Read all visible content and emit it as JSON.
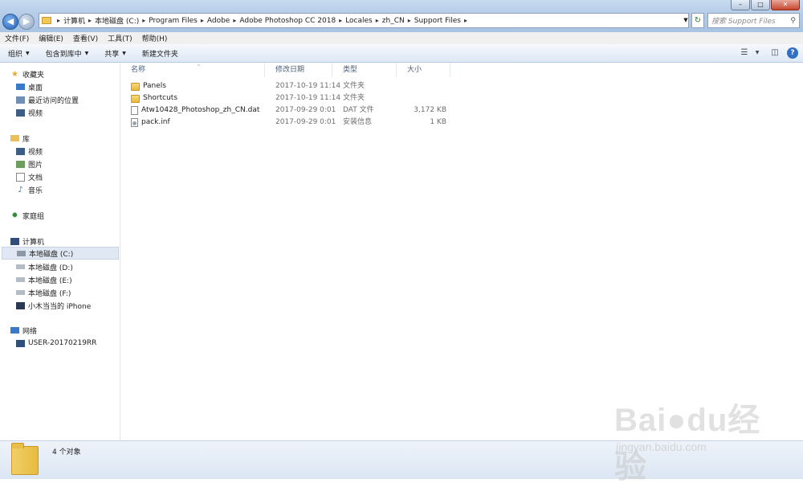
{
  "window": {
    "controls": [
      "minimize",
      "maximize",
      "close"
    ]
  },
  "address": {
    "crumbs": [
      "计算机",
      "本地磁盘 (C:)",
      "Program Files",
      "Adobe",
      "Adobe Photoshop CC 2018",
      "Locales",
      "zh_CN",
      "Support Files"
    ]
  },
  "search": {
    "placeholder": "搜索 Support Files"
  },
  "menu": [
    "文件(F)",
    "编辑(E)",
    "查看(V)",
    "工具(T)",
    "帮助(H)"
  ],
  "toolbar": {
    "organize": "组织",
    "include": "包含到库中",
    "share": "共享",
    "newfolder": "新建文件夹"
  },
  "sidebar": {
    "favorites": {
      "label": "收藏夹",
      "items": [
        "桌面",
        "最近访问的位置",
        "视频"
      ]
    },
    "libraries": {
      "label": "库",
      "items": [
        "视频",
        "图片",
        "文档",
        "音乐"
      ]
    },
    "homegroup": "家庭组",
    "computer": {
      "label": "计算机",
      "items": [
        "本地磁盘 (C:)",
        "本地磁盘 (D:)",
        "本地磁盘 (E:)",
        "本地磁盘 (F:)",
        "小木当当的 iPhone"
      ]
    },
    "network": {
      "label": "网络",
      "items": [
        "USER-20170219RR"
      ]
    }
  },
  "columns": [
    "名称",
    "修改日期",
    "类型",
    "大小"
  ],
  "files": [
    {
      "name": "Panels",
      "date": "2017-10-19 11:14",
      "type": "文件夹",
      "size": "",
      "icon": "folder"
    },
    {
      "name": "Shortcuts",
      "date": "2017-10-19 11:14",
      "type": "文件夹",
      "size": "",
      "icon": "folder"
    },
    {
      "name": "Atw10428_Photoshop_zh_CN.dat",
      "date": "2017-09-29 0:01",
      "type": "DAT 文件",
      "size": "3,172 KB",
      "icon": "doc"
    },
    {
      "name": "pack.inf",
      "date": "2017-09-29 0:01",
      "type": "安装信息",
      "size": "1 KB",
      "icon": "inf"
    }
  ],
  "status": {
    "count": "4 个对象"
  },
  "watermark": {
    "brand": "Baidu经验",
    "url": "jingyan.baidu.com"
  }
}
